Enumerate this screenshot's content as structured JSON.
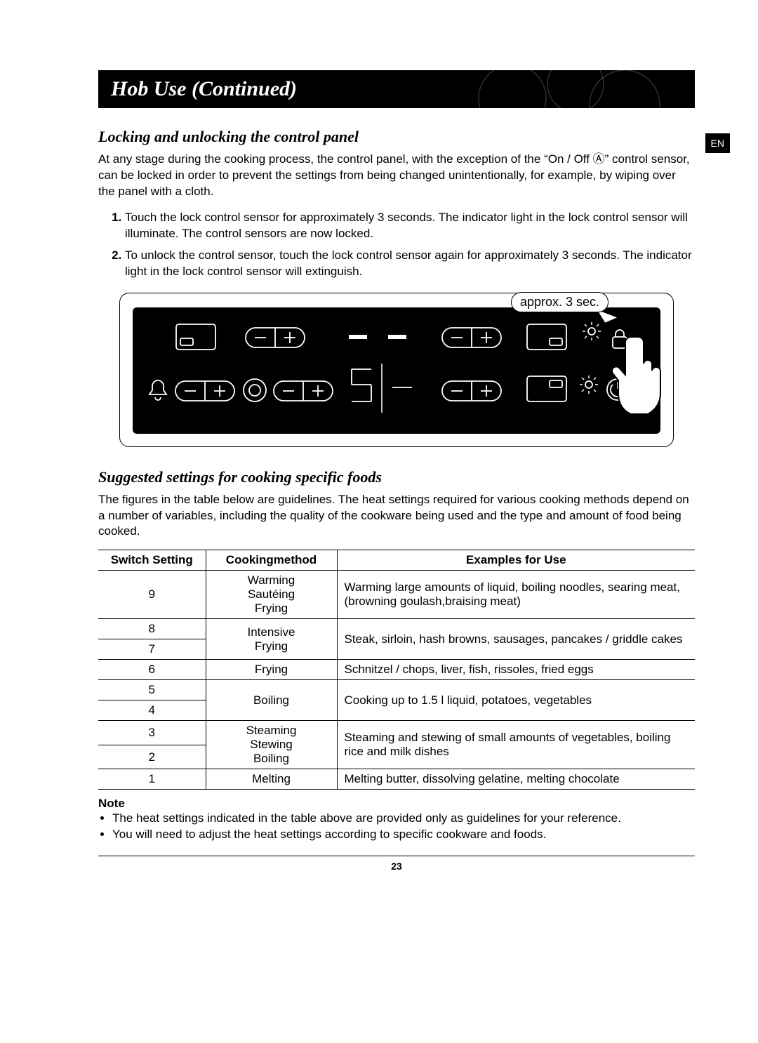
{
  "lang_tab": "EN",
  "page_title": "Hob Use (Continued)",
  "section1": {
    "heading": "Locking and unlocking the control panel",
    "intro": "At any stage during the cooking process, the control panel, with the exception of the “On / Off Ⓐ” control sensor, can be locked in order to prevent the settings from being changed unintentionally, for example, by wiping over the panel with a cloth.",
    "steps": [
      "Touch the lock control sensor for approximately 3 seconds. The indicator light in the lock control sensor will illuminate. The control sensors are now locked.",
      "To unlock the control sensor, touch the lock control sensor again for approximately 3 seconds. The indicator light in the lock control sensor will extinguish."
    ],
    "figure_callout": "approx. 3 sec."
  },
  "section2": {
    "heading": "Suggested settings for cooking specific foods",
    "intro": "The figures in the table below are guidelines. The heat settings required for various cooking methods depend on a number of variables, including the quality of the cookware being used and the type and amount of food being cooked.",
    "table": {
      "headers": [
        "Switch Setting",
        "Cookingmethod",
        "Examples for Use"
      ],
      "rows": [
        {
          "setting": "9",
          "method": "Warming\nSautéing\nFrying",
          "example": "Warming large amounts of liquid, boiling noodles, searing meat, (browning goulash,braising meat)"
        },
        {
          "setting": "8\n7",
          "method": "Intensive\nFrying",
          "example": "Steak, sirloin, hash browns, sausages, pancakes / griddle cakes"
        },
        {
          "setting": "6",
          "method": "Frying",
          "example": "Schnitzel / chops, liver, fish, rissoles, fried eggs"
        },
        {
          "setting": "5\n4",
          "method": "Boiling",
          "example": "Cooking up to 1.5 l liquid, potatoes, vegetables"
        },
        {
          "setting": "3\n2",
          "method": "Steaming\nStewing\nBoiling",
          "example": "Steaming and stewing of small amounts of vegetables, boiling rice and milk dishes"
        },
        {
          "setting": "1",
          "method": "Melting",
          "example": "Melting butter, dissolving gelatine, melting chocolate"
        }
      ]
    }
  },
  "note": {
    "heading": "Note",
    "items": [
      "The heat settings indicated in the table above are provided only as guidelines for your reference.",
      "You will need to adjust the heat settings according to specific cookware and foods."
    ]
  },
  "page_number": "23"
}
